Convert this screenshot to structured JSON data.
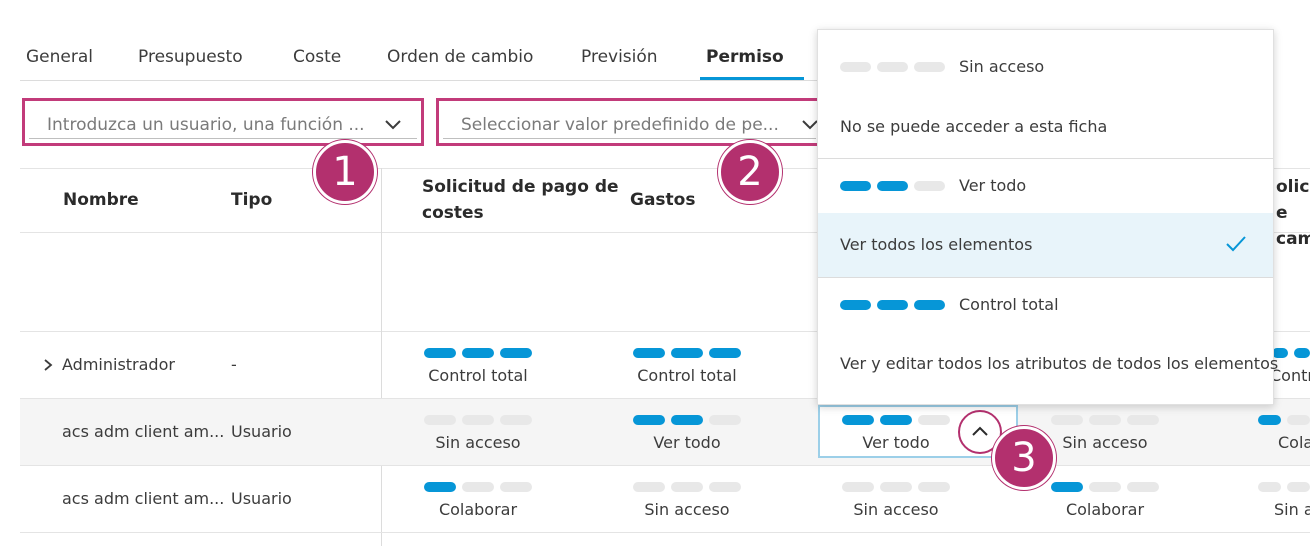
{
  "tabs": [
    {
      "label": "General"
    },
    {
      "label": "Presupuesto"
    },
    {
      "label": "Coste"
    },
    {
      "label": "Orden de cambio"
    },
    {
      "label": "Previsión"
    },
    {
      "label": "Permiso",
      "active": true
    }
  ],
  "filters": {
    "user_placeholder": "Introduzca un usuario, una función ...",
    "preset_placeholder": "Seleccionar valor predefinido de pe..."
  },
  "callouts": [
    "1",
    "2",
    "3"
  ],
  "table": {
    "headers": {
      "name": "Nombre",
      "type": "Tipo",
      "col1_line1": "Solicitud de pago de",
      "col1_line2": "costes",
      "col2": "Gastos",
      "col5_line1": "olicit",
      "col5_line2": "e cam"
    },
    "rows": [
      {
        "name": "Administrador",
        "type": "-",
        "cells": [
          {
            "label": "Control total",
            "level": 3
          },
          {
            "label": "Control total",
            "level": 3
          },
          {
            "label": "Contro",
            "level": 3
          }
        ]
      },
      {
        "name": "acs adm client am...",
        "type": "Usuario",
        "cells": [
          {
            "label": "Sin acceso",
            "level": 0
          },
          {
            "label": "Ver todo",
            "level": 2
          },
          {
            "label": "Ver todo",
            "level": 2
          },
          {
            "label": "Sin acceso",
            "level": 0
          },
          {
            "label": "Cola",
            "level": 1
          }
        ]
      },
      {
        "name": "acs adm client am...",
        "type": "Usuario",
        "cells": [
          {
            "label": "Colaborar",
            "level": 1
          },
          {
            "label": "Sin acceso",
            "level": 0
          },
          {
            "label": "Sin acceso",
            "level": 0
          },
          {
            "label": "Colaborar",
            "level": 1
          },
          {
            "label": "Sin a",
            "level": 0
          }
        ]
      }
    ]
  },
  "dropdown": {
    "options": [
      {
        "level_name": "Sin acceso",
        "level": 0,
        "description": "No se puede acceder a esta ficha"
      },
      {
        "level_name": "Ver todo",
        "level": 2,
        "description": "Ver todos los elementos",
        "selected": true
      },
      {
        "level_name": "Control total",
        "level": 3,
        "description": "Ver y editar todos los atributos de todos los elementos"
      }
    ]
  },
  "colors": {
    "accent": "#0696d7",
    "callout": "#b3306e",
    "bar_off": "#e8e8e8",
    "selected_bg": "#e8f4fa"
  }
}
